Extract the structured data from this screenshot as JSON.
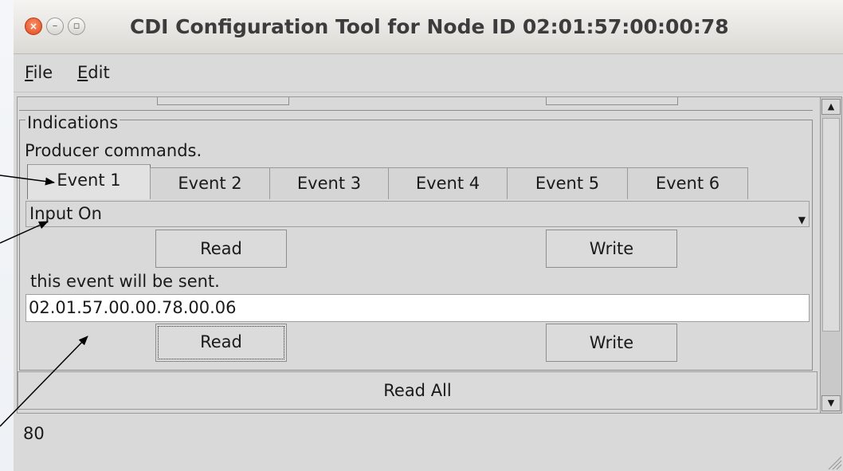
{
  "window": {
    "title": "CDI Configuration Tool for Node ID 02:01:57:00:00:78",
    "close_glyph": "×",
    "minimize_glyph": "–",
    "maximize_glyph": "▫"
  },
  "menubar": {
    "file_mnemonic": "F",
    "file_rest": "ile",
    "edit_mnemonic": "E",
    "edit_rest": "dit"
  },
  "indications": {
    "group_label": "Indications",
    "description": "Producer commands.",
    "tabs": [
      {
        "label": "Event 1",
        "active": true
      },
      {
        "label": "Event 2",
        "active": false
      },
      {
        "label": "Event 3",
        "active": false
      },
      {
        "label": "Event 4",
        "active": false
      },
      {
        "label": "Event 5",
        "active": false
      },
      {
        "label": "Event 6",
        "active": false
      }
    ],
    "combo_value": "Input On",
    "read_label": "Read",
    "write_label": "Write",
    "sent_label": "this event will be sent.",
    "event_id_value": "02.01.57.00.00.78.00.06"
  },
  "read_all_label": "Read All",
  "status_number": "80",
  "colors": {
    "close_button": "#e0461a",
    "window_bg": "#d9d9d9"
  },
  "icons": {
    "combo": "chevron-down-icon",
    "scroll_up": "arrow-up-icon",
    "scroll_down": "arrow-down-icon"
  }
}
